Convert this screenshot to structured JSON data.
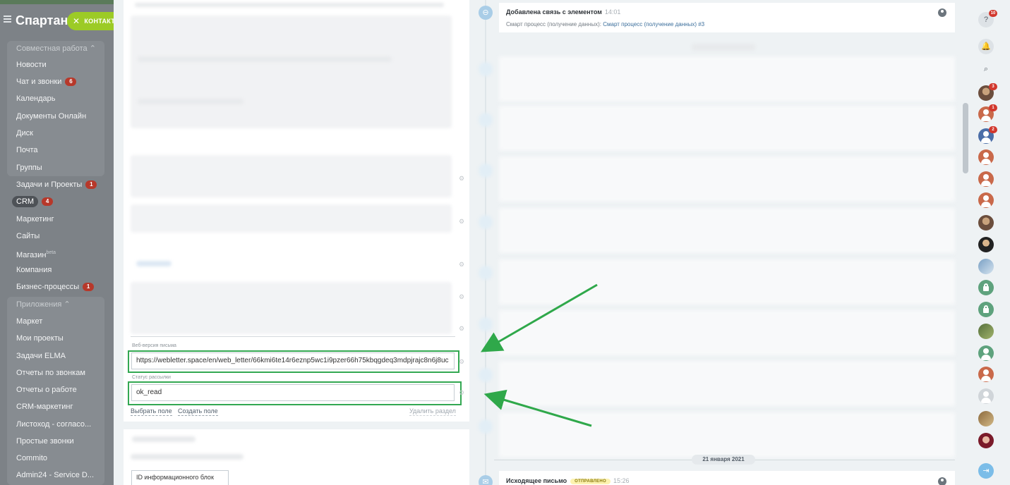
{
  "sidebar": {
    "brand": "Спартант",
    "contact_button": "КОНТАКТ",
    "group_collab": "Совместная работа",
    "group_apps": "Приложения",
    "items": [
      {
        "label": "Новости",
        "badge": ""
      },
      {
        "label": "Чат и звонки",
        "badge": "6"
      },
      {
        "label": "Календарь",
        "badge": ""
      },
      {
        "label": "Документы Онлайн",
        "badge": ""
      },
      {
        "label": "Диск",
        "badge": ""
      },
      {
        "label": "Почта",
        "badge": ""
      },
      {
        "label": "Группы",
        "badge": ""
      },
      {
        "label": "Задачи и Проекты",
        "badge": "1"
      },
      {
        "label": "CRM",
        "badge": "4"
      },
      {
        "label": "Маркетинг",
        "badge": ""
      },
      {
        "label": "Сайты",
        "badge": ""
      },
      {
        "label": "Магазин",
        "badge": "",
        "sup": "beta"
      },
      {
        "label": "Компания",
        "badge": ""
      },
      {
        "label": "Бизнес-процессы",
        "badge": "1"
      }
    ],
    "apps": [
      "Маркет",
      "Мои проекты",
      "Задачи ELMA",
      "Отчеты по звонкам",
      "Отчеты о работе",
      "CRM-маркетинг",
      "Листоход - согласо...",
      "Простые звонки",
      "Commito",
      "Admin24 - Service D..."
    ]
  },
  "form": {
    "web_version_label": "Веб-версия письма",
    "web_version_value": "https://webletter.space/en/web_letter/66kmi6te14r6eznp5wc1i9pzer66h75kbqgdeq3mdpjrajc8n6j8uc",
    "status_label": "Статус рассылки",
    "status_value": "ok_read",
    "select_field": "Выбрать поле",
    "create_field": "Создать поле",
    "delete_section": "Удалить раздел",
    "partial_field": "ID информационного блок"
  },
  "timeline": {
    "top_event": {
      "title": "Добавлена связь с элементом",
      "time": "14:01",
      "sub_prefix": "Смарт процесс (получение данных):",
      "sub_link": "Смарт процесс (получение данных) #3"
    },
    "date_separator": "21 января 2021",
    "bottom_event": {
      "title": "Исходящее письмо",
      "status": "ОТПРАВЛЕНО",
      "time": "15:26"
    }
  },
  "rail": {
    "help_count": "10",
    "counts": [
      "3",
      "1",
      "2"
    ]
  },
  "colors": {
    "highlight": "#33a852",
    "arrow": "#2fa84a",
    "contact_green": "#9ccb26",
    "badge_red": "#b7382a"
  }
}
